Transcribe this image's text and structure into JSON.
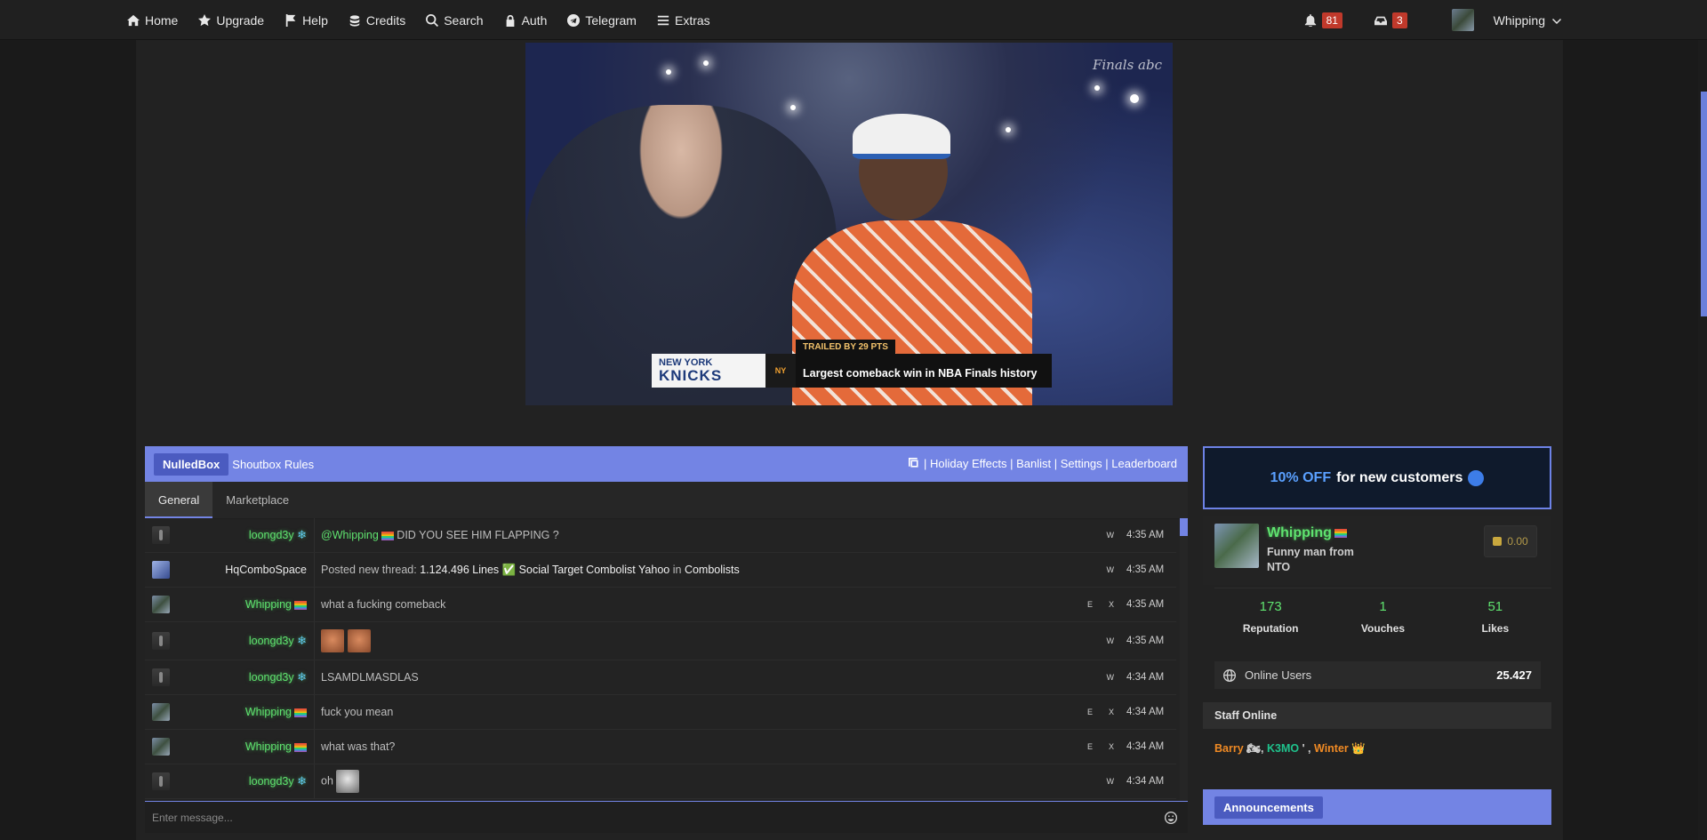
{
  "nav": {
    "items": [
      {
        "label": "Home",
        "icon": "home-icon"
      },
      {
        "label": "Upgrade",
        "icon": "star-icon"
      },
      {
        "label": "Help",
        "icon": "flag-icon"
      },
      {
        "label": "Credits",
        "icon": "coins-icon"
      },
      {
        "label": "Search",
        "icon": "search-icon"
      },
      {
        "label": "Auth",
        "icon": "lock-icon"
      },
      {
        "label": "Telegram",
        "icon": "telegram-icon"
      },
      {
        "label": "Extras",
        "icon": "menu-icon"
      }
    ],
    "notifications_count": "81",
    "inbox_count": "3",
    "username": "Whipping"
  },
  "video": {
    "network_logo": "Finals abc",
    "team_city": "NEW YORK",
    "team_name": "KNICKS",
    "tag": "TRAILED BY 29 PTS",
    "caption": "Largest comeback win in NBA Finals history"
  },
  "shoutbox": {
    "brand": "NulledBox",
    "rules": "Shoutbox Rules",
    "links": "| Holiday Effects | Banlist | Settings | Leaderboard",
    "tabs": [
      "General",
      "Marketplace"
    ],
    "messages": [
      {
        "user": "loongd3y",
        "text": "@Whipping DID YOU SEE HIM FLAPPING ?",
        "flags": [
          "W"
        ],
        "time": "4:35 AM"
      },
      {
        "user": "HqComboSpace",
        "text_prefix": "Posted new thread:",
        "thread": "1.124.496 Lines ✅ Social Target Combolist Yahoo",
        "text_in": "in",
        "forum": "Combolists",
        "flags": [
          "W"
        ],
        "time": "4:35 AM"
      },
      {
        "user": "Whipping",
        "text": "what a fucking comeback",
        "flags": [
          "E",
          "X"
        ],
        "time": "4:35 AM"
      },
      {
        "user": "loongd3y",
        "text": "",
        "flags": [
          "W"
        ],
        "time": "4:35 AM"
      },
      {
        "user": "loongd3y",
        "text": "LSAMDLMASDLAS",
        "flags": [
          "W"
        ],
        "time": "4:34 AM"
      },
      {
        "user": "Whipping",
        "text": "fuck you mean",
        "flags": [
          "E",
          "X"
        ],
        "time": "4:34 AM"
      },
      {
        "user": "Whipping",
        "text": "what was that?",
        "flags": [
          "E",
          "X"
        ],
        "time": "4:34 AM"
      },
      {
        "user": "loongd3y",
        "text": "oh",
        "flags": [
          "W"
        ],
        "time": "4:34 AM"
      }
    ],
    "input_placeholder": "Enter message..."
  },
  "sidebar": {
    "promo_highlight": "10% OFF",
    "promo_text": "for new customers",
    "profile_name": "Whipping",
    "profile_title": "Funny man from NTO",
    "credits": "0.00",
    "stats": [
      {
        "value": "173",
        "label": "Reputation"
      },
      {
        "value": "1",
        "label": "Vouches"
      },
      {
        "value": "51",
        "label": "Likes"
      }
    ],
    "online_label": "Online Users",
    "online_count": "25.427",
    "staff_heading": "Staff Online",
    "staff": [
      "Barry",
      "K3MO",
      "Winter"
    ],
    "announcements": "Announcements"
  },
  "colors": {
    "accent": "#7384e4",
    "username_green": "#5fe36f",
    "badge_red": "#c0392b",
    "staff_orange": "#f08a24",
    "staff_teal": "#1fc28c"
  }
}
